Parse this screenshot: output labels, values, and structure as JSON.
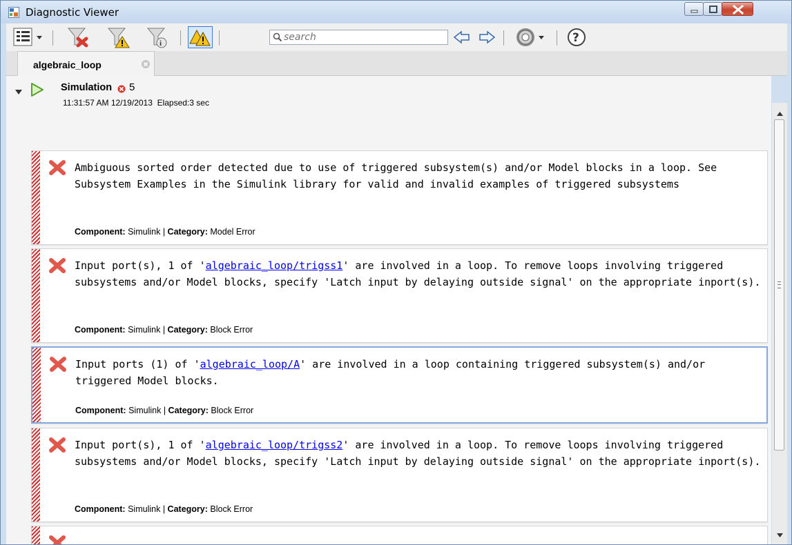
{
  "window": {
    "title": "Diagnostic Viewer"
  },
  "toolbar": {
    "search_placeholder": "search"
  },
  "tab": {
    "label": "algebraic_loop"
  },
  "simulation": {
    "title": "Simulation",
    "error_count": "5",
    "timestamp": "11:31:57 AM 12/19/2013",
    "elapsed": "Elapsed:3 sec"
  },
  "messages": [
    {
      "text": "Ambiguous sorted order detected due to use of triggered subsystem(s) and/or Model blocks in a loop. See Subsystem Examples in the Simulink library for valid and invalid examples of triggered subsystems",
      "component_label": "Component:",
      "component": "Simulink",
      "category_label": "Category:",
      "category": "Model Error"
    },
    {
      "text_before": "Input port(s), 1 of '",
      "link": "algebraic_loop/trigss1",
      "text_after": "' are involved in a loop. To remove loops involving triggered subsystems and/or Model blocks, specify 'Latch input by delaying outside signal' on the appropriate inport(s).",
      "component_label": "Component:",
      "component": "Simulink",
      "category_label": "Category:",
      "category": "Block Error"
    },
    {
      "text_before": "Input ports (1) of '",
      "link": "algebraic_loop/A",
      "text_after": "' are involved in a loop containing triggered subsystem(s) and/or triggered Model blocks.",
      "component_label": "Component:",
      "component": "Simulink",
      "category_label": "Category:",
      "category": "Block Error"
    },
    {
      "text_before": "Input port(s), 1 of '",
      "link": "algebraic_loop/trigss2",
      "text_after": "' are involved in a loop. To remove loops involving triggered subsystems and/or Model blocks, specify 'Latch input by delaying outside signal' on the appropriate inport(s).",
      "component_label": "Component:",
      "component": "Simulink",
      "category_label": "Category:",
      "category": "Block Error"
    }
  ]
}
